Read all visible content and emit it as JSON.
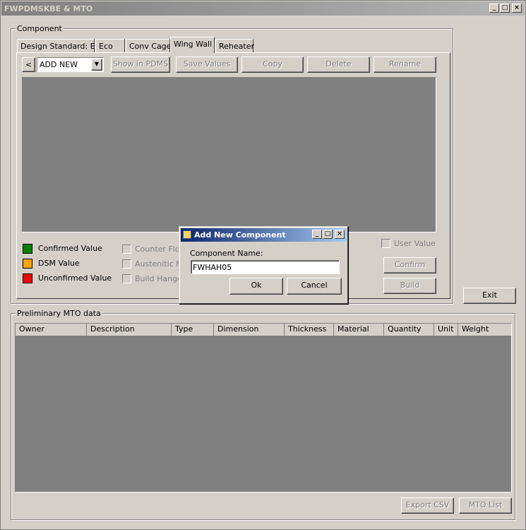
{
  "window": {
    "title": "FWPDMSKBE & MTO",
    "controls": [
      "_",
      "□",
      "×"
    ]
  },
  "component_group": {
    "label": "Component",
    "tabs": [
      "Design Standard: EN",
      "Eco",
      "Conv Cage",
      "Wing Wall",
      "Reheater"
    ],
    "active_tab": "Wing Wall",
    "prev_button": "<",
    "combo_value": "ADD NEW",
    "toolbar": {
      "show_in_pdms": "Show in PDMS",
      "save_values": "Save Values",
      "copy": "Copy",
      "delete": "Delete",
      "rename": "Rename"
    },
    "legend": {
      "confirmed": "Confirmed Value",
      "dsm": "DSM Value",
      "unconfirmed": "Unconfirmed Value",
      "colors": {
        "confirmed": "#008000",
        "dsm": "#ffa500",
        "unconfirmed": "#ff0000"
      }
    },
    "options": {
      "counter_flow": "Counter Flow",
      "austenitic": "Austenitic Ma",
      "build_hanger": "Build Hanger"
    },
    "user_value": "User Value",
    "confirm": "Confirm",
    "build": "Build"
  },
  "exit_button": "Exit",
  "mto_group": {
    "label": "Preliminary MTO data",
    "columns": [
      "Owner",
      "Description",
      "Type",
      "Dimension",
      "Thickness",
      "Material",
      "Quantity",
      "Unit",
      "Weight"
    ],
    "export_csv": "Export CSV",
    "mto_list": "MTO List"
  },
  "dialog": {
    "title": "Add New Component",
    "field_label": "Component Name:",
    "field_value": "FWHAH05",
    "ok": "Ok",
    "cancel": "Cancel"
  }
}
